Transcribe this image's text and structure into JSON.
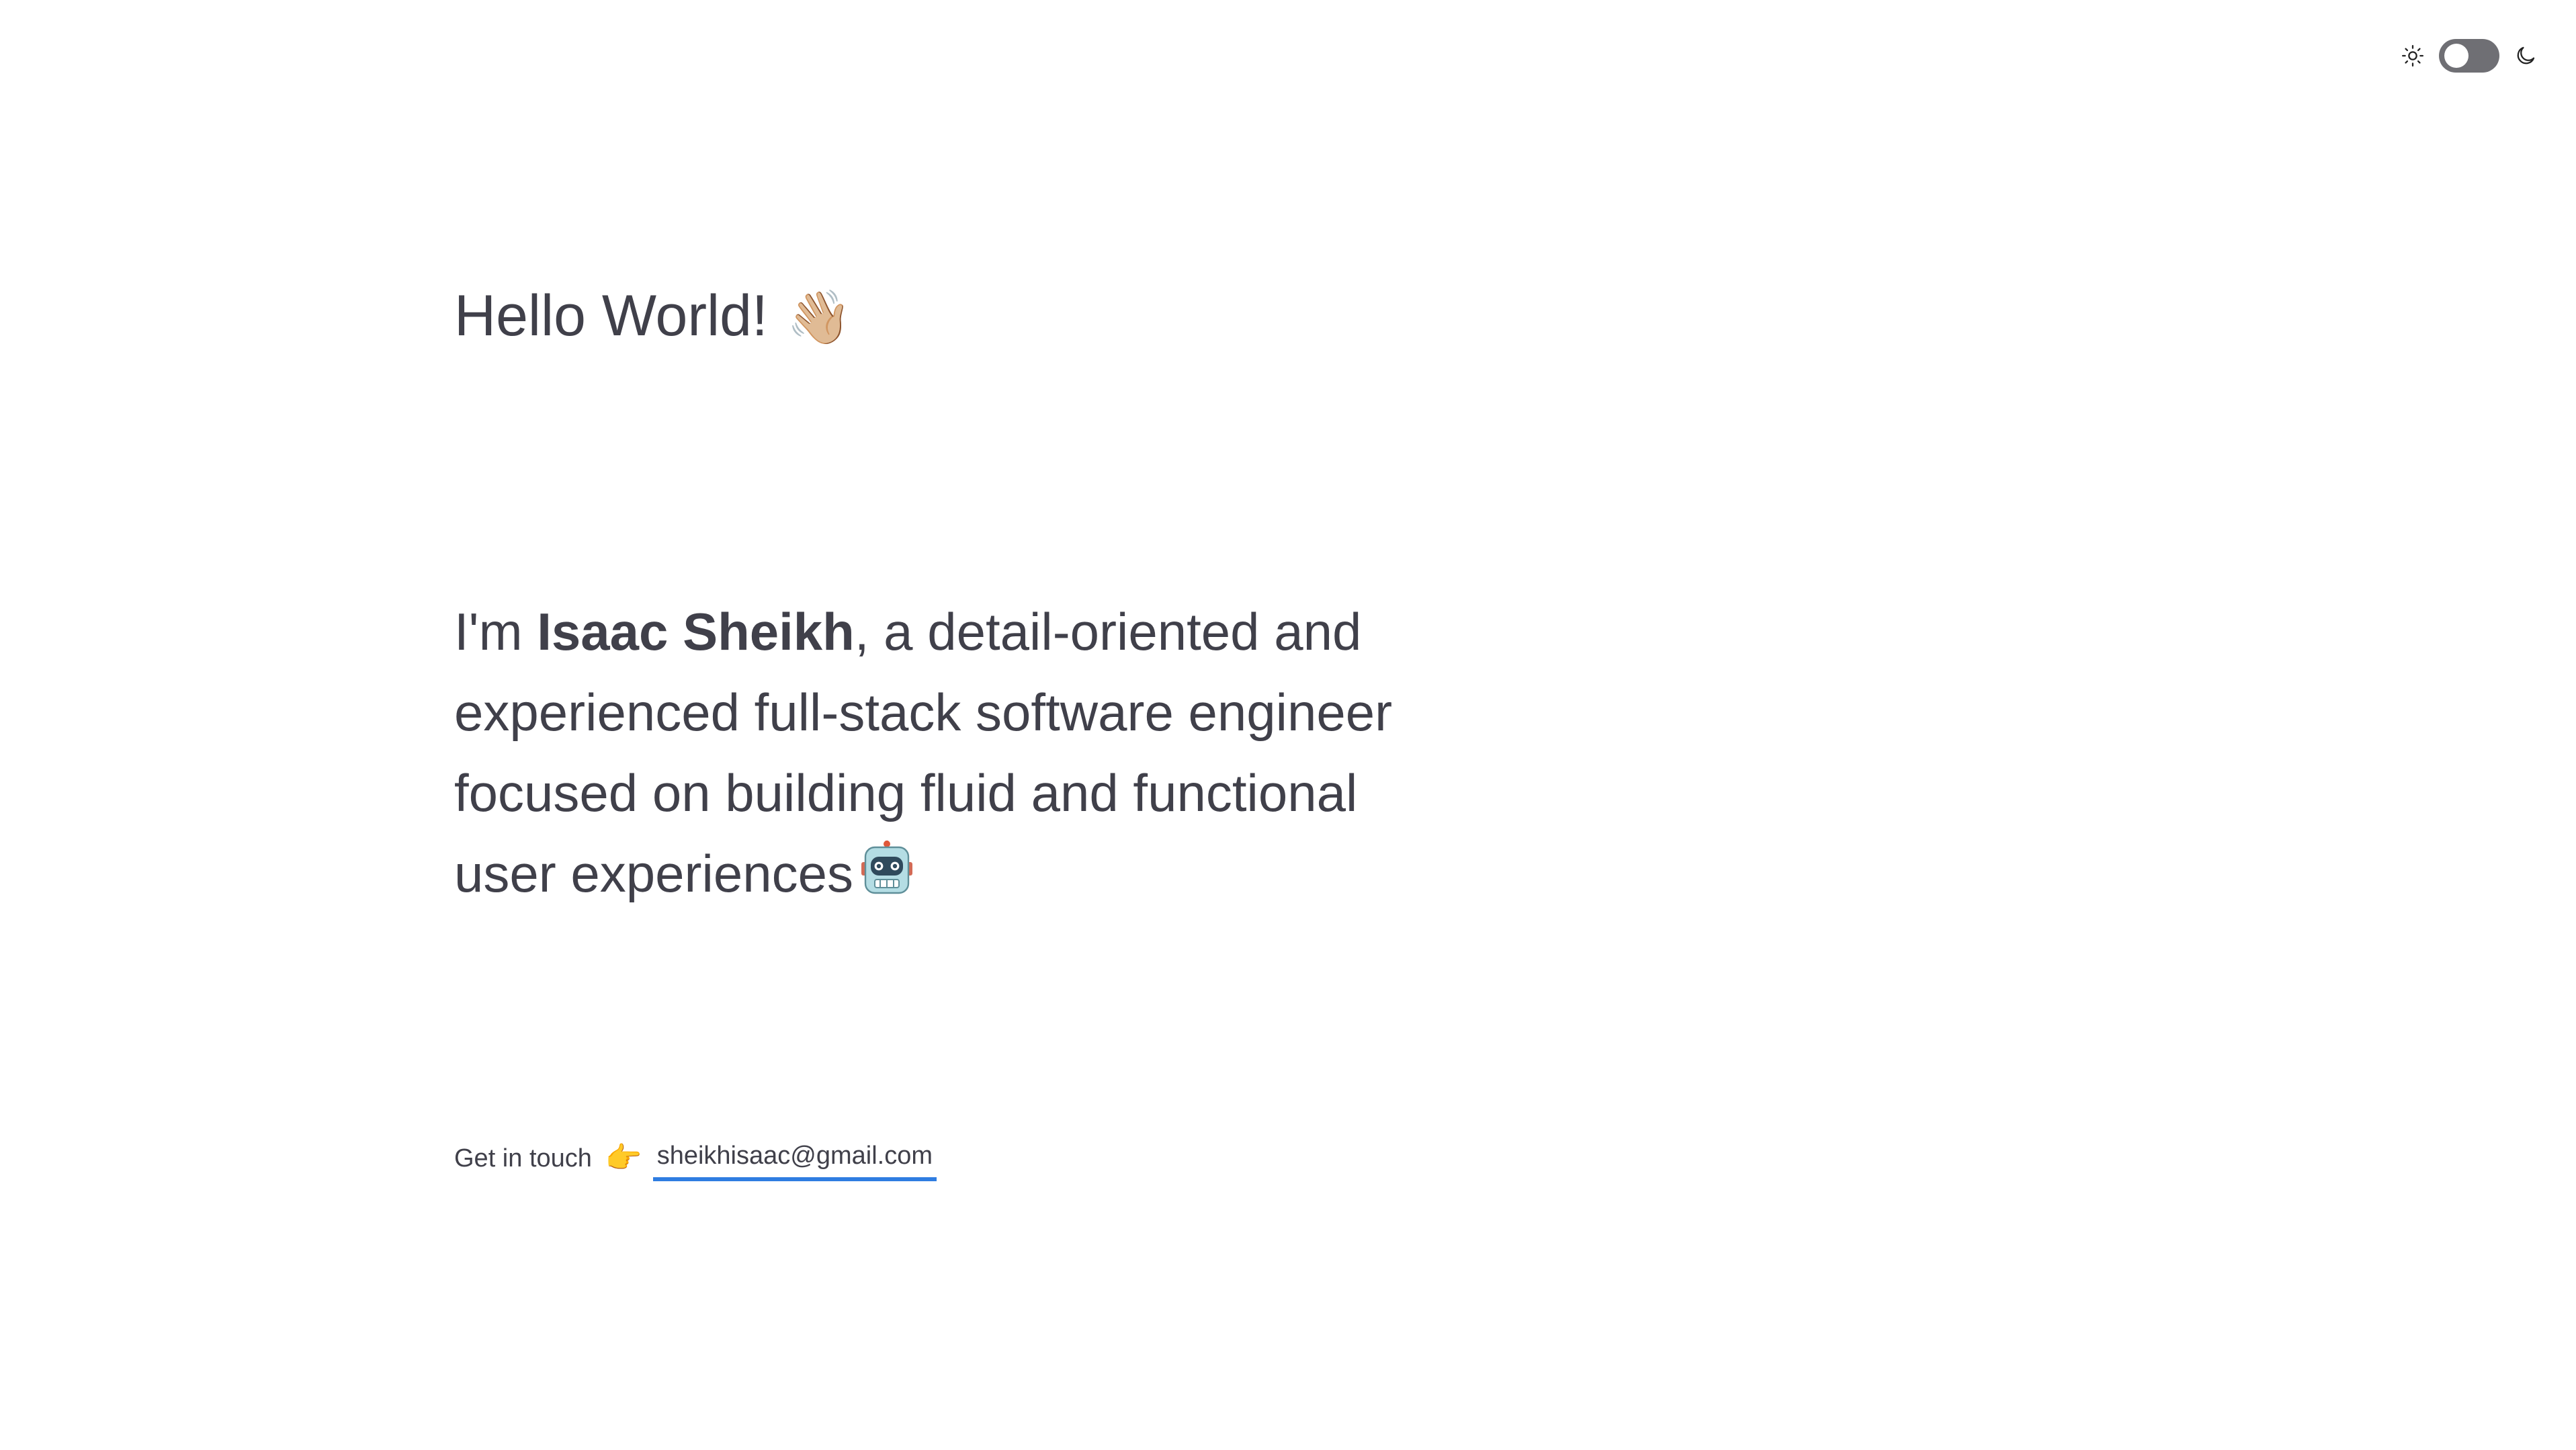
{
  "theme_toggle": {
    "light_icon": "sun-icon",
    "dark_icon": "moon-icon",
    "state": "light"
  },
  "hero": {
    "greeting": "Hello World!",
    "greeting_emoji": "👋🏼",
    "intro_prefix": "I'm ",
    "name": "Isaac Sheikh",
    "intro_suffix": ", a detail-oriented and experienced full-stack software engineer focused on building fluid and functional user experiences",
    "intro_emoji": "robot-icon"
  },
  "contact": {
    "label": "Get in touch",
    "pointer_emoji": "👉",
    "email": "sheikhisaac@gmail.com",
    "link_color": "#2f7de1"
  }
}
